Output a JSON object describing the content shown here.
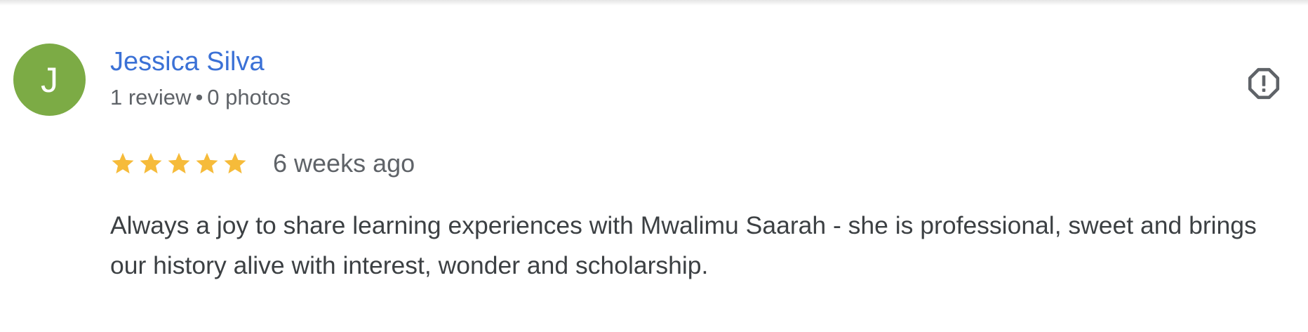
{
  "review": {
    "author": {
      "initial": "J",
      "name": "Jessica Silva",
      "reviews": "1 review",
      "separator": "•",
      "photos": "0 photos",
      "avatar_color": "#7cab45",
      "name_color": "#3b71d6"
    },
    "rating": 5,
    "rating_max": 5,
    "star_color": "#f6bb3a",
    "date": "6 weeks ago",
    "text": "Always a joy to share learning experiences with Mwalimu Saarah - she is professional, sweet and brings our history alive with interest, wonder and scholarship.",
    "report_icon": "report-flag-icon"
  }
}
